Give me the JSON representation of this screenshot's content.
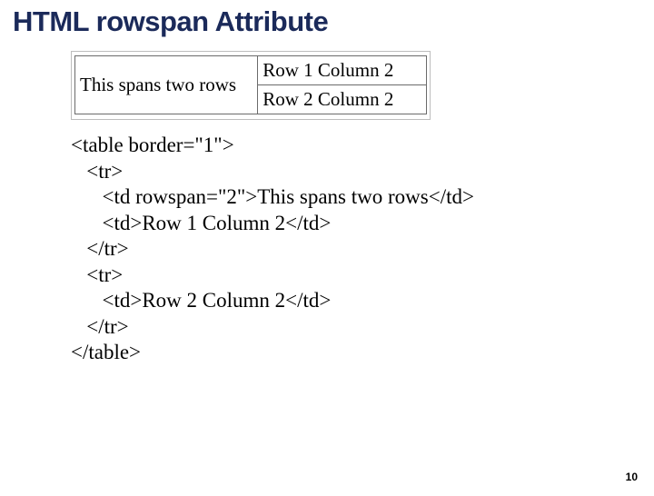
{
  "title": "HTML rowspan Attribute",
  "example": {
    "spanCell": "This spans two rows",
    "r1c2": "Row 1 Column 2",
    "r2c2": "Row 2 Column 2"
  },
  "code": {
    "l1": "<table border=\"1\">",
    "l2": "   <tr>",
    "l3": "      <td rowspan=\"2\">This spans two rows</td>",
    "l4": "      <td>Row 1 Column 2</td>",
    "l5": "   </tr>",
    "l6": "   <tr>",
    "l7": "      <td>Row 2 Column 2</td>",
    "l8": "   </tr>",
    "l9": "</table>"
  },
  "pageNumber": "10"
}
